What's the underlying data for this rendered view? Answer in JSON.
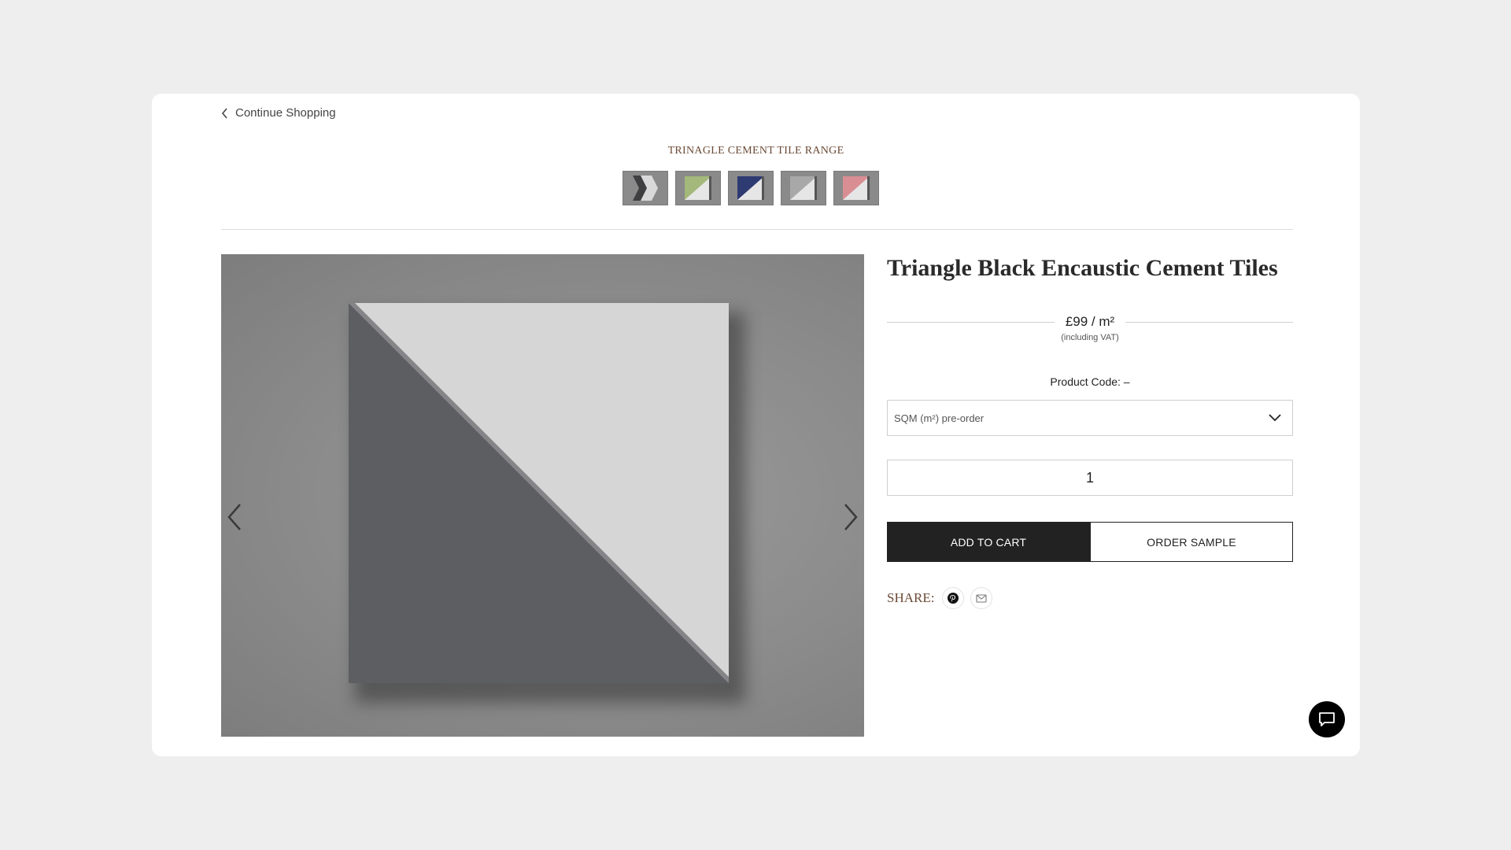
{
  "nav": {
    "back_label": "Continue Shopping"
  },
  "range": {
    "title": "TRINAGLE CEMENT TILE RANGE",
    "swatches": [
      {
        "name": "black",
        "color": "#4a4a4a"
      },
      {
        "name": "green",
        "color": "#a3b87a"
      },
      {
        "name": "blue",
        "color": "#2e3a72"
      },
      {
        "name": "grey",
        "color": "#a8a8a8"
      },
      {
        "name": "pink",
        "color": "#d98e94"
      }
    ]
  },
  "product": {
    "title": "Triangle Black Encaustic Cement Tiles",
    "price": "£99 / m²",
    "vat_note": "(including VAT)",
    "code_label": "Product Code: –",
    "unit_select": "SQM (m²) pre-order",
    "quantity": "1"
  },
  "actions": {
    "add_to_cart": "ADD TO CART",
    "order_sample": "ORDER SAMPLE"
  },
  "share": {
    "label": "SHARE:"
  },
  "colors": {
    "accent_brown": "#6b4a36",
    "button_dark": "#222222",
    "tile_dark": "#5d5e62",
    "tile_light": "#d6d6d6"
  }
}
